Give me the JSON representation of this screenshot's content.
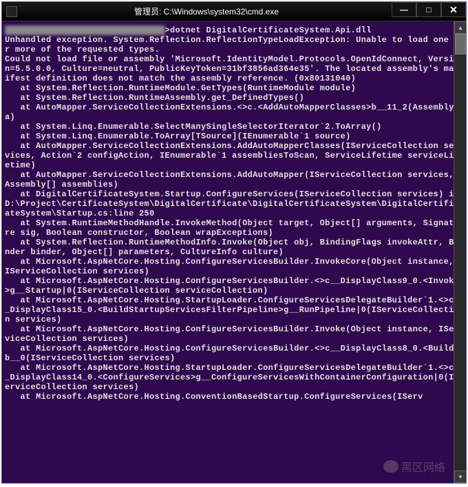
{
  "titlebar": {
    "text": "管理员: C:\\Windows\\system32\\cmd.exe"
  },
  "win_buttons": {
    "min": "—",
    "max": "□",
    "close": "✕"
  },
  "scroll": {
    "up": "▲",
    "down": "▼"
  },
  "watermark": "黑区网络",
  "console": {
    "cmd_prefix_redacted": "I XXXXXXXXXXXXXXXXXXXXXXXXXXXXX",
    "cmd_suffix": ">dotnet DigitalCertificateSystem.Api.dll",
    "lines": [
      "Unhandled exception. System.Reflection.ReflectionTypeLoadException: Unable to load one or more of the requested types.",
      "Could not load file or assembly 'Microsoft.IdentityModel.Protocols.OpenIdConnect, Version=5.5.0.0, Culture=neutral, PublicKeyToken=31bf3856ad364e35'. The located assembly's manifest definition does not match the assembly reference. (0x80131040)",
      "   at System.Reflection.RuntimeModule.GetTypes(RuntimeModule module)",
      "   at System.Reflection.RuntimeAssembly.get_DefinedTypes()",
      "   at AutoMapper.ServiceCollectionExtensions.<>c.<AddAutoMapperClasses>b__11_2(Assembly a)",
      "   at System.Linq.Enumerable.SelectManySingleSelectorIterator`2.ToArray()",
      "   at System.Linq.Enumerable.ToArray[TSource](IEnumerable`1 source)",
      "   at AutoMapper.ServiceCollectionExtensions.AddAutoMapperClasses(IServiceCollection services, Action`2 configAction, IEnumerable`1 assembliesToScan, ServiceLifetime serviceLifetime)",
      "   at AutoMapper.ServiceCollectionExtensions.AddAutoMapper(IServiceCollection services, Assembly[] assemblies)",
      "   at DigitalCertificateSystem.Startup.ConfigureServices(IServiceCollection services) in D:\\Project\\CertificateSystem\\DigitalCertificate\\DigitalCertificateSystem\\DigitalCertificateSystem\\Startup.cs:line 250",
      "   at System.RuntimeMethodHandle.InvokeMethod(Object target, Object[] arguments, Signature sig, Boolean constructor, Boolean wrapExceptions)",
      "   at System.Reflection.RuntimeMethodInfo.Invoke(Object obj, BindingFlags invokeAttr, Binder binder, Object[] parameters, CultureInfo culture)",
      "   at Microsoft.AspNetCore.Hosting.ConfigureServicesBuilder.InvokeCore(Object instance, IServiceCollection services)",
      "   at Microsoft.AspNetCore.Hosting.ConfigureServicesBuilder.<>c__DisplayClass9_0.<Invoke>g__Startup|0(IServiceCollection serviceCollection)",
      "   at Microsoft.AspNetCore.Hosting.StartupLoader.ConfigureServicesDelegateBuilder`1.<>c__DisplayClass15_0.<BuildStartupServicesFilterPipeline>g__RunPipeline|0(IServiceCollection services)",
      "   at Microsoft.AspNetCore.Hosting.ConfigureServicesBuilder.Invoke(Object instance, IServiceCollection services)",
      "   at Microsoft.AspNetCore.Hosting.ConfigureServicesBuilder.<>c__DisplayClass8_0.<Build>b__0(IServiceCollection services)",
      "   at Microsoft.AspNetCore.Hosting.StartupLoader.ConfigureServicesDelegateBuilder`1.<>c__DisplayClass14_0.<ConfigureServices>g__ConfigureServicesWithContainerConfiguration|0(IServiceCollection services)",
      "   at Microsoft.AspNetCore.Hosting.ConventionBasedStartup.ConfigureServices(IServ"
    ]
  }
}
